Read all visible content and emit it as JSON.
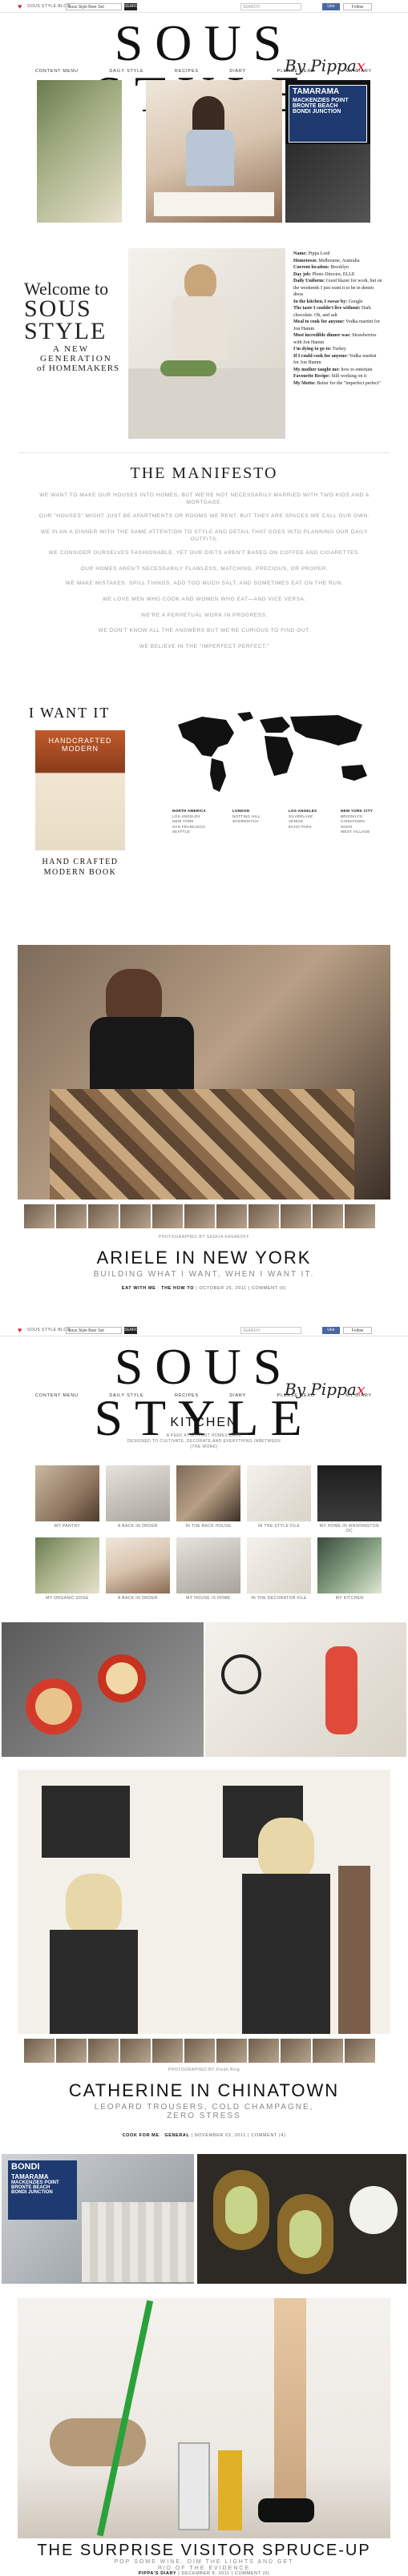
{
  "topbar": {
    "blog_link": "SOUS STYLE BLOG",
    "select_value": "Sous Style Beer Set",
    "go": "SEARCH",
    "search_placeholder": "SEARCH",
    "like": "Like",
    "follow": "Follow"
  },
  "logo": {
    "word": "SOUS STYLE",
    "byline": "By Pippa",
    "mark": "x"
  },
  "nav": [
    "CONTENT MENU",
    "DAILY STYLE",
    "RECIPES",
    "DIARY",
    "PLEASE READ",
    "MY DIARY"
  ],
  "welcome": {
    "line1": "Welcome to",
    "line2": "SOUS",
    "line3": "STYLE",
    "line4": "A NEW",
    "line5": "GENERATION",
    "line6": "of HOMEMAKERS"
  },
  "profile": [
    {
      "k": "Name:",
      "v": "Pippa Lord"
    },
    {
      "k": "Hometown:",
      "v": "Melbourne, Australia"
    },
    {
      "k": "Current location:",
      "v": "Brooklyn"
    },
    {
      "k": "Day job:",
      "v": "Photo Director, ELLE"
    },
    {
      "k": "Daily Uniform:",
      "v": "Good blazer for work, but on the weekends I just want it to be in denim dress"
    },
    {
      "k": "In the kitchen, I swear by:",
      "v": "Google"
    },
    {
      "k": "The taste I couldn't live without:",
      "v": "Dark chocolate. Oh, and salt"
    },
    {
      "k": "Meal to cook for anyone:",
      "v": "Vodka martini for Jon Hamm"
    },
    {
      "k": "Most incredible dinner was:",
      "v": "Strawberries with Jon Hamm"
    },
    {
      "k": "I'm dying to go to:",
      "v": "Turkey"
    },
    {
      "k": "If I could cook for anyone:",
      "v": "Vodka martini for Jon Hamm"
    },
    {
      "k": "My mother taught me:",
      "v": "how to entertain"
    },
    {
      "k": "Favourite Recipe:",
      "v": "Still working on it"
    },
    {
      "k": "My Motto:",
      "v": "Better for the \"imperfect perfect\""
    }
  ],
  "manifesto": {
    "title": "THE MANIFESTO",
    "lines": [
      "WE WANT TO MAKE OUR HOUSES INTO HOMES, BUT WE'RE NOT NECESSARILY MARRIED WITH TWO KIDS AND A MORTGAGE.",
      "OUR \"HOUSES\" MIGHT JUST BE APARTMENTS OR ROOMS WE RENT, BUT THEY ARE SPACES WE CALL OUR OWN.",
      "WE PLAN A DINNER WITH THE SAME ATTENTION TO STYLE AND DETAIL THAT GOES INTO PLANNING OUR DAILY OUTFITS.",
      "WE CONSIDER OURSELVES FASHIONABLE, YET OUR DIETS AREN'T BASED ON COFFEE AND CIGARETTES.",
      "OUR HOMES AREN'T NECESSARILY FLAWLESS, MATCHING, PRECIOUS, OR PROPER.",
      "WE MAKE MISTAKES. SPILL THINGS. ADD TOO MUCH SALT, AND SOMETIMES EAT ON THE RUN.",
      "WE LOVE MEN WHO COOK AND WOMEN WHO EAT—AND VICE VERSA.",
      "WE'RE A PERPETUAL WORK IN PROGRESS.",
      "WE DON'T KNOW ALL THE ANSWERS BUT WE'RE CURIOUS TO FIND OUT.",
      "WE BELIEVE IN THE \"IMPERFECT PERFECT.\""
    ]
  },
  "want": {
    "title": "I WANT IT",
    "book_cover": "HANDCRAFTED MODERN",
    "book_caption_1": "HAND CRAFTED",
    "book_caption_2": "MODERN BOOK",
    "cities": [
      {
        "h": "NORTH AMERICA",
        "items": [
          "LOS ANGELES",
          "NEW YORK",
          "SAN FRANCISCO",
          "SEATTLE"
        ]
      },
      {
        "h": "LONDON",
        "items": [
          "NOTTING HILL",
          "SHOREDITCH"
        ]
      },
      {
        "h": "LOS ANGELES",
        "items": [
          "SILVERLAKE",
          "VENICE",
          "ECHO PARK"
        ]
      },
      {
        "h": "NEW YORK CITY",
        "items": [
          "BROOKLYN",
          "CHINATOWN",
          "SOHO",
          "WEST VILLAGE"
        ]
      }
    ]
  },
  "post1": {
    "credit": "PHOTOGRAPHED BY SASKIA KASAKOFF",
    "title": "ARIELE IN NEW YORK",
    "subtitle": "BUILDING WHAT I WANT, WHEN I WANT IT.",
    "meta_author": "EAT WITH ME",
    "meta_cat": "THE HOW TO",
    "meta_date": "OCTOBER 25, 2011",
    "meta_comments": "COMMENT (0)"
  },
  "kitchen": {
    "title": "KITCHEN",
    "desc_1": "A PEEK AT MY PAST HOMES BACK",
    "desc_2": "DESIGNED TO CULTIVATE, DECORATE AND EVERYTHING INBETWEEN",
    "desc_3": "(THE WORK)",
    "labels": [
      "MY PANTRY",
      "A BACK IN ORDER",
      "IN THE BACK HOUSE",
      "IN THE STYLE FILE",
      "MY HOME IN WASHINGTON DC",
      "MY ORGANIC EDGE",
      "A BACK IN ORDER",
      "MY HOUSE IS HOME",
      "IN THE DECORATOR FILE",
      "MY KITCHEN"
    ]
  },
  "post2": {
    "credit": "PHOTOGRAPHED BY Dinah Blog",
    "title": "CATHERINE IN CHINATOWN",
    "subtitle_1": "LEOPARD TROUSERS, COLD CHAMPAGNE,",
    "subtitle_2": "ZERO STRESS",
    "meta_author": "COOK FOR ME",
    "meta_cat": "GENERAL",
    "meta_date": "NOVEMBER 03, 2011",
    "meta_comments": "COMMENT (4)"
  },
  "post3": {
    "sign_1": "BONDI",
    "sign_2": "TAMARAMA",
    "sign_3": "MACKENZIES POINT",
    "sign_4": "BRONTE BEACH",
    "sign_5": "BONDI JUNCTION",
    "title": "THE SURPRISE VISITOR SPRUCE-UP",
    "subtitle_1": "POP SOME WINE, DIM THE LIGHTS AND GET",
    "subtitle_2": "RID OF THE EVIDENCE",
    "meta_author": "PIPPA'S DIARY",
    "meta_date": "DECEMBER 9, 2011",
    "meta_comments": "COMMENT (0)"
  },
  "hero_sign": {
    "l1": "TAMARAMA",
    "l2": "MACKENZIES POINT",
    "l3": "BRONTE BEACH",
    "l4": "BONDI JUNCTION"
  }
}
